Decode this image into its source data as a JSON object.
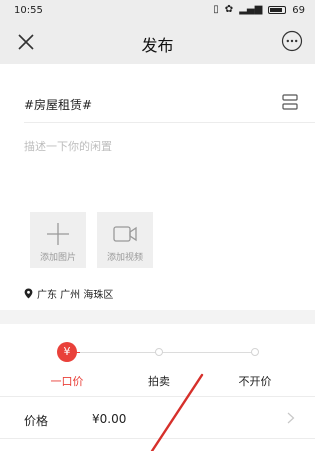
{
  "status_bar": {
    "time": "10:55",
    "battery": "69"
  },
  "nav": {
    "title": "发布"
  },
  "topic": {
    "tag": "#房屋租赁#"
  },
  "description": {
    "placeholder": "描述一下你的闲置"
  },
  "media": {
    "add_image_label": "添加图片",
    "add_video_label": "添加视频"
  },
  "location": {
    "text": "广东 广州 海珠区"
  },
  "sale_type": {
    "active_symbol": "¥",
    "options": [
      "一口价",
      "拍卖",
      "不开价"
    ],
    "selected": "一口价"
  },
  "price": {
    "label": "价格",
    "value": "¥0.00"
  },
  "colors": {
    "accent": "#e9413a",
    "nav_bg": "#ededed"
  },
  "icons": [
    "close-icon",
    "more-icon",
    "scan-icon",
    "plus-icon",
    "video-camera-icon",
    "location-pin-icon",
    "chevron-right-icon"
  ]
}
